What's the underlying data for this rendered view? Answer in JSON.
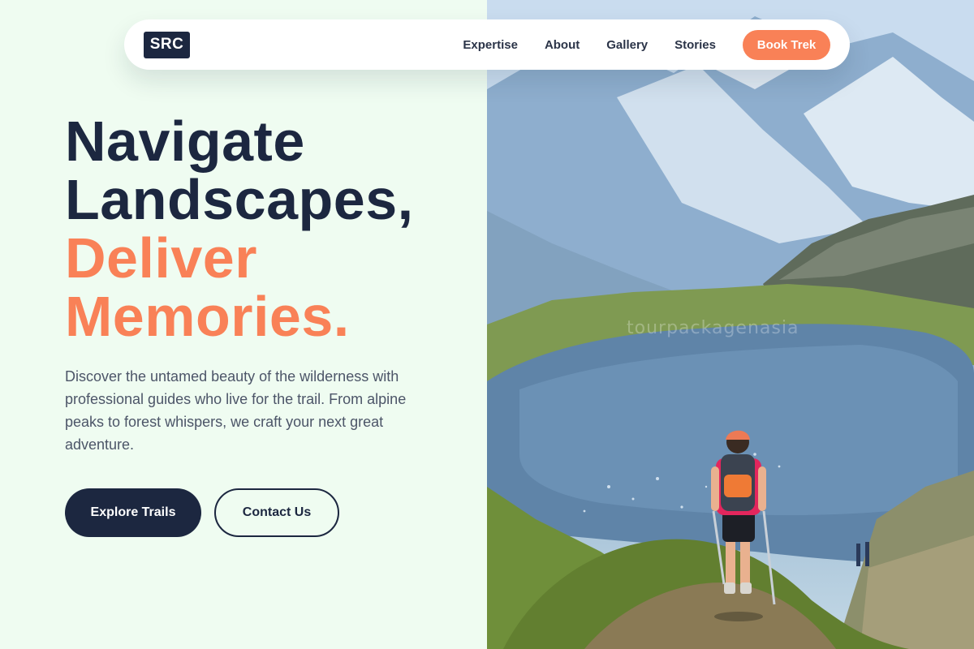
{
  "brand": {
    "logo_text": "SRC"
  },
  "nav": {
    "links": [
      "Expertise",
      "About",
      "Gallery",
      "Stories"
    ],
    "cta_label": "Book Trek"
  },
  "hero": {
    "headline_line_1": "Navigate",
    "headline_line_2": "Landscapes,",
    "headline_line_3": "Deliver",
    "headline_line_4": "Memories.",
    "description": "Discover the untamed beauty of the wilderness with professional guides who live for the trail. From alpine peaks to forest whispers, we craft your next great adventure.",
    "primary_button": "Explore Trails",
    "secondary_button": "Contact Us"
  },
  "photo": {
    "watermark": "tourpackagenasia",
    "subject": "hiker with trekking poles overlooking alpine lake below snowy mountains"
  },
  "colors": {
    "background": "#effcf1",
    "navy": "#1c2740",
    "accent_orange": "#f98157",
    "body_text": "#4c5568"
  }
}
